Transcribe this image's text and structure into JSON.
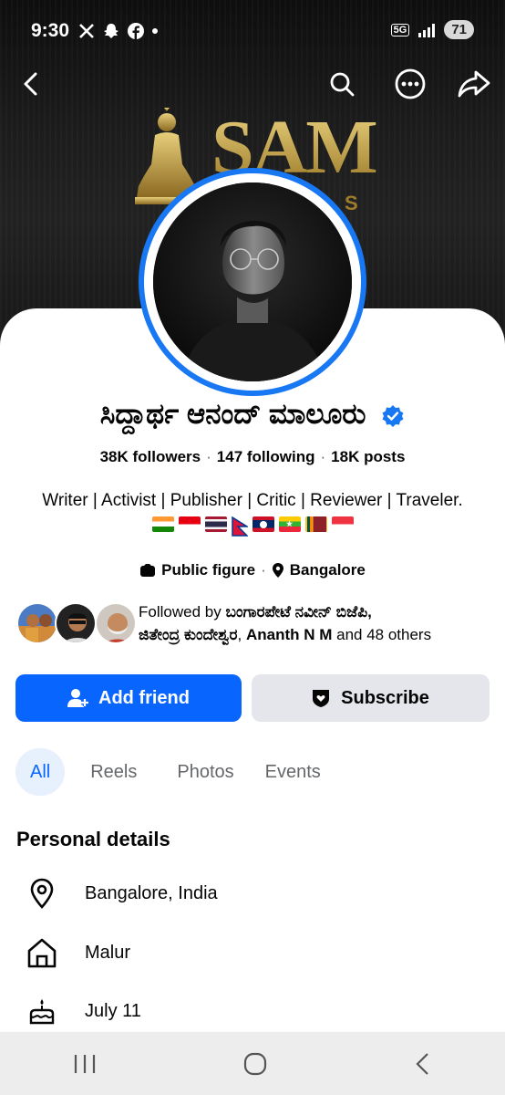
{
  "status_bar": {
    "time": "9:30",
    "left_icons": [
      "x-app-icon",
      "snapchat-icon",
      "facebook-icon",
      "dot"
    ],
    "network": "5G",
    "battery": "71"
  },
  "nav": {
    "back": "chevron-left-icon",
    "search": "search-icon",
    "more": "more-icon",
    "share": "share-icon"
  },
  "cover": {
    "logo_text": "SAM",
    "logo_sub": "S"
  },
  "profile": {
    "name": "ಸಿದ್ದಾರ್ಥ ಆನಂದ್ ಮಾಲೂರು",
    "verified": true,
    "followers": "38K followers",
    "following": "147 following",
    "posts": "18K posts",
    "bio": "Writer | Activist | Publisher | Critic | Reviewer | Traveler.",
    "flags": [
      "India",
      "Indonesia",
      "Thailand",
      "Nepal",
      "Laos",
      "Myanmar",
      "Sri Lanka",
      "Singapore"
    ],
    "category": "Public figure",
    "location": "Bangalore"
  },
  "followed_by": {
    "prefix": "Followed by ",
    "name1": "ಬಂಗಾರಪೇಟೆ ನವೀನ್ ಬಿಜೆಪಿ,",
    "name2": "ಜಿತೇಂದ್ರ ಕುಂದೇಶ್ವರ",
    "sep": ", ",
    "name3": "Ananth N M",
    "suffix": " and 48 others"
  },
  "actions": {
    "add_friend": "Add friend",
    "subscribe": "Subscribe"
  },
  "tabs": [
    "All",
    "Reels",
    "Photos",
    "Events"
  ],
  "personal": {
    "title": "Personal details",
    "items": [
      {
        "icon": "location-pin-icon",
        "text": "Bangalore, India"
      },
      {
        "icon": "home-icon",
        "text": "Malur"
      },
      {
        "icon": "birthday-cake-icon",
        "text": "July 11"
      }
    ]
  },
  "colors": {
    "accent": "#0866ff",
    "verified": "#1877f2",
    "secondary_button": "#e4e6eb",
    "tab_active_bg": "#e7f0fd"
  }
}
